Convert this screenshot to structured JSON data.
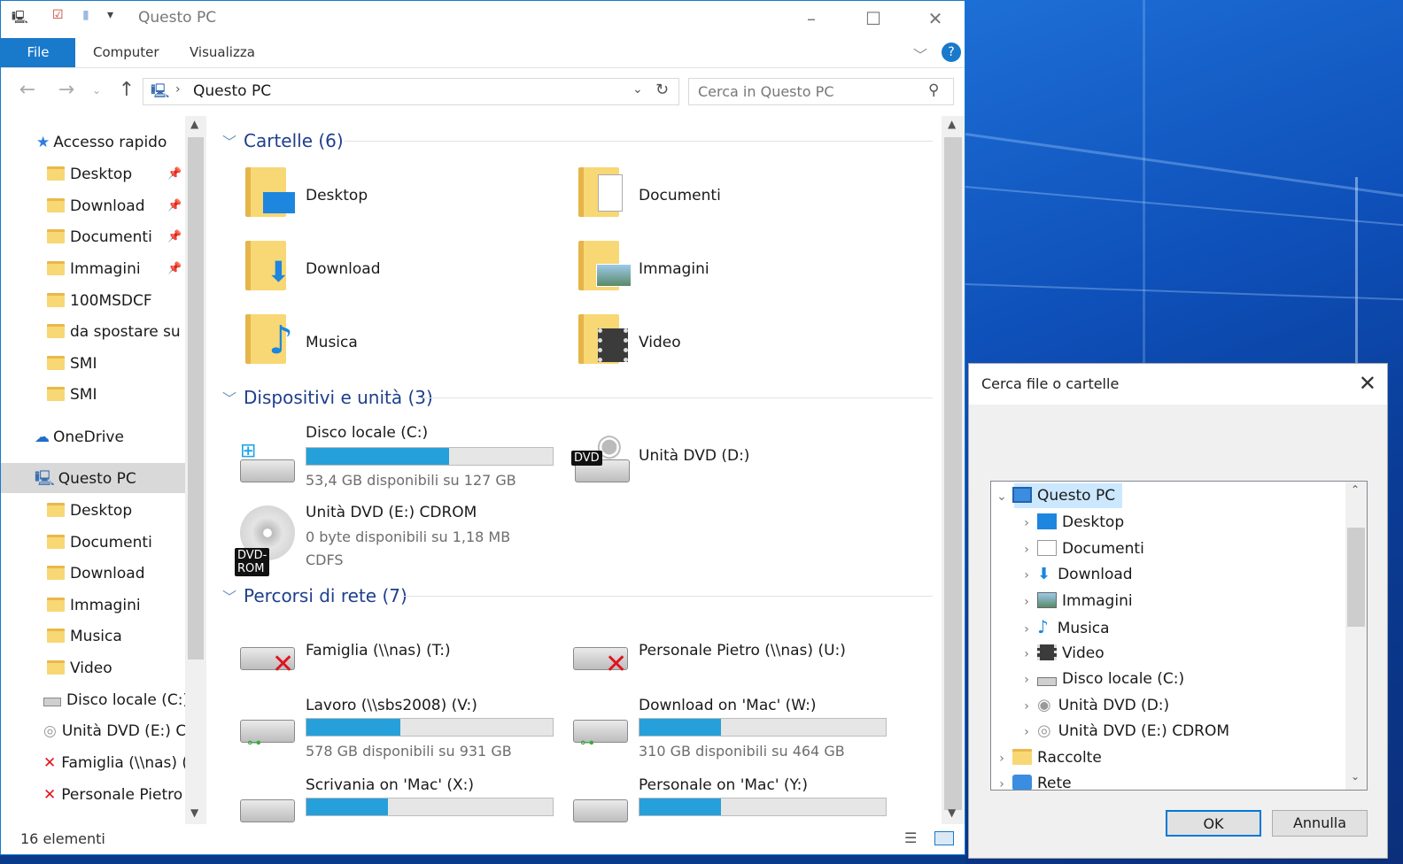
{
  "window": {
    "title": "Questo PC",
    "ribbon_tabs": [
      "File",
      "Computer",
      "Visualizza"
    ],
    "address": "Questo PC",
    "search_placeholder": "Cerca in Questo PC",
    "status": "16 elementi"
  },
  "nav": {
    "quick_access": "Accesso rapido",
    "quick_items": [
      "Desktop",
      "Download",
      "Documenti",
      "Immagini",
      "100MSDCF",
      "da spostare su m",
      "SMI",
      "SMI"
    ],
    "onedrive": "OneDrive",
    "this_pc": "Questo PC",
    "pc_items": [
      "Desktop",
      "Documenti",
      "Download",
      "Immagini",
      "Musica",
      "Video",
      "Disco locale (C:)",
      "Unità DVD (E:) CI",
      "Famiglia (\\\\nas) (",
      "Personale Pietro"
    ]
  },
  "content": {
    "folders_header": "Cartelle (6)",
    "folders": [
      "Desktop",
      "Documenti",
      "Download",
      "Immagini",
      "Musica",
      "Video"
    ],
    "devices_header": "Dispositivi e unità (3)",
    "devices": [
      {
        "name": "Disco locale (C:)",
        "info": "53,4 GB disponibili su 127 GB",
        "used_fraction": 0.58
      },
      {
        "name": "Unità DVD (D:)",
        "badge": "DVD"
      },
      {
        "name": "Unità DVD (E:) CDROM",
        "info": "0 byte disponibili su 1,18 MB",
        "fs": "CDFS",
        "badge": "DVD-ROM"
      }
    ],
    "network_header": "Percorsi di rete (7)",
    "network": [
      {
        "name": "Famiglia (\\\\nas) (T:)",
        "disconnected": true
      },
      {
        "name": "Personale Pietro (\\\\nas) (U:)",
        "disconnected": true
      },
      {
        "name": "Lavoro (\\\\sbs2008) (V:)",
        "info": "578 GB disponibili su 931 GB",
        "used_fraction": 0.38
      },
      {
        "name": "Download on 'Mac' (W:)",
        "info": "310 GB disponibili su 464 GB",
        "used_fraction": 0.33
      },
      {
        "name": "Scrivania on 'Mac' (X:)",
        "used_fraction": 0.33
      },
      {
        "name": "Personale on 'Mac' (Y:)",
        "used_fraction": 0.33
      }
    ]
  },
  "dialog": {
    "title": "Cerca file o cartelle",
    "tree": [
      "Questo PC",
      "Desktop",
      "Documenti",
      "Download",
      "Immagini",
      "Musica",
      "Video",
      "Disco locale (C:)",
      "Unità DVD (D:)",
      "Unità DVD (E:) CDROM",
      "Raccolte",
      "Rete"
    ],
    "ok": "OK",
    "cancel": "Annulla"
  }
}
